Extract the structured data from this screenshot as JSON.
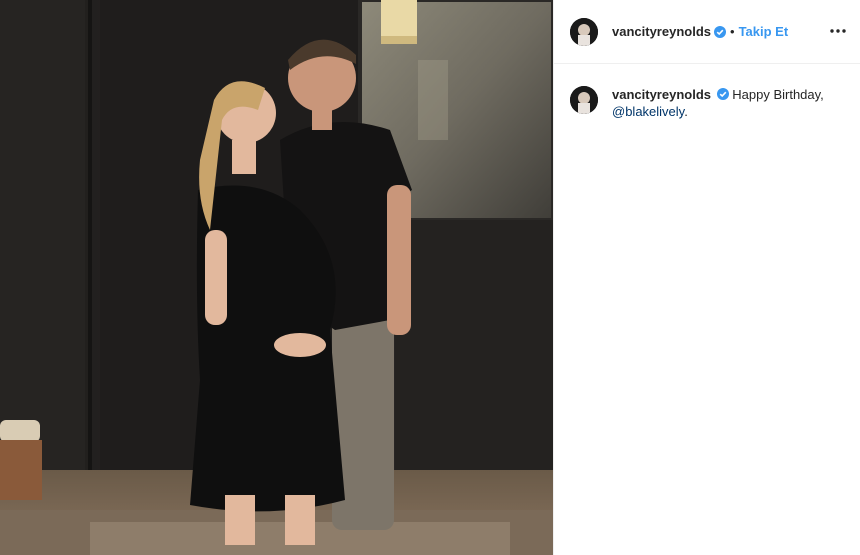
{
  "post": {
    "image_alt": "Couple posing in a dark room",
    "header": {
      "username": "vancityreynolds",
      "separator": "•",
      "follow_label": "Takip Et"
    },
    "caption": {
      "username": "vancityreynolds",
      "text": "Happy Birthday,",
      "mention": "@blakelively",
      "end": "."
    }
  },
  "colors": {
    "accent": "#3897f0",
    "mention": "#003569",
    "verified": "#3897f0"
  },
  "icons": {
    "verified": "verified-badge-icon",
    "more": "more-options-icon"
  }
}
